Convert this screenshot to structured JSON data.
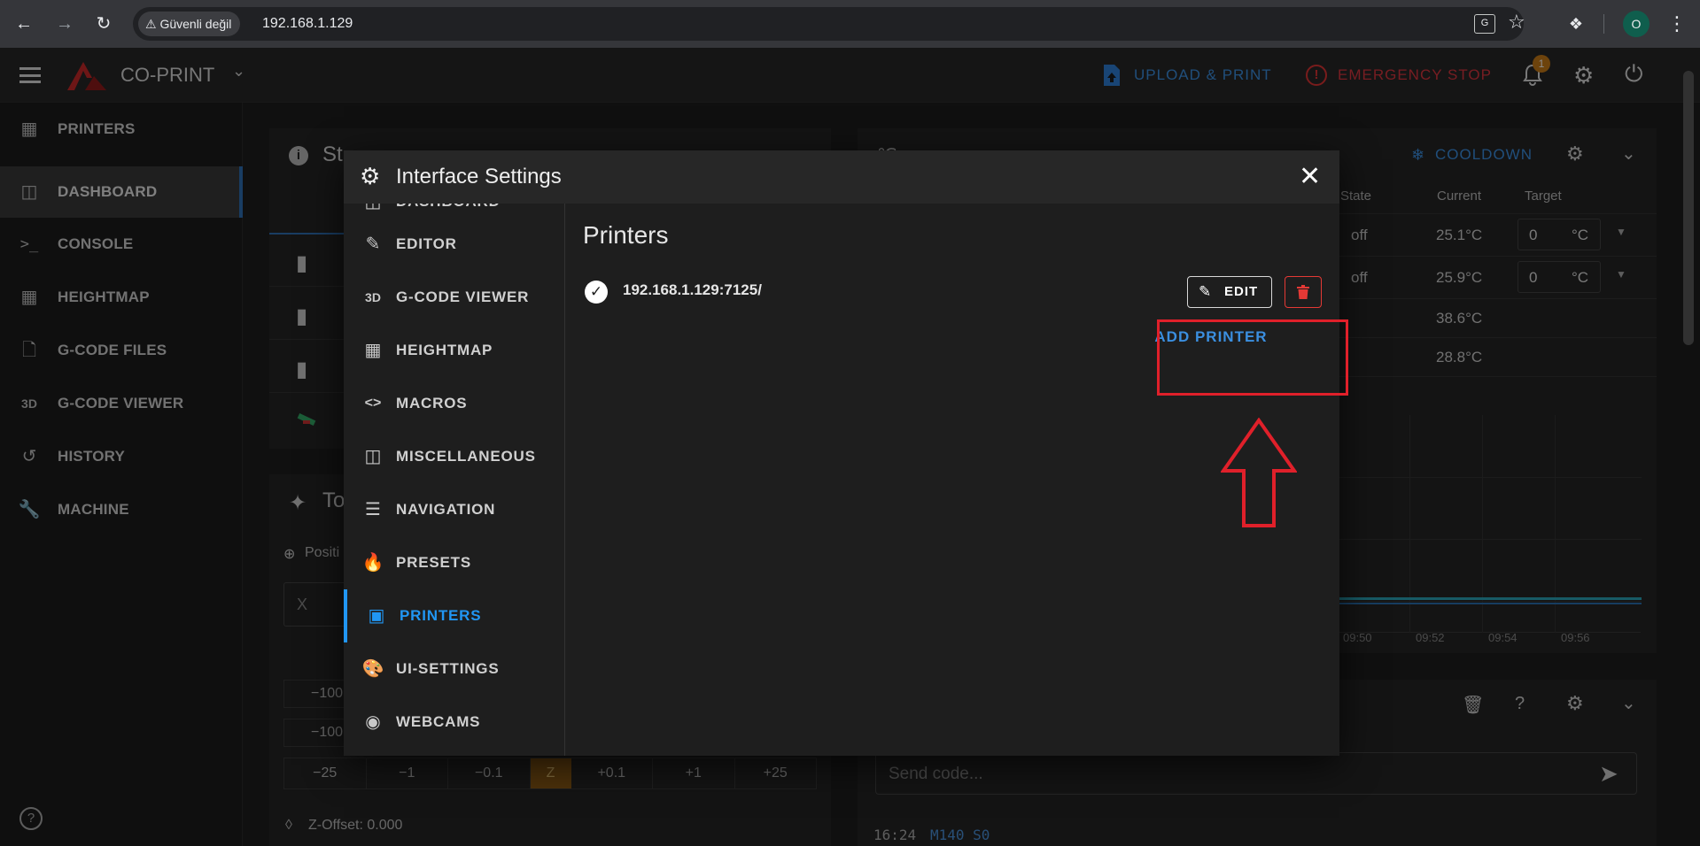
{
  "browser": {
    "security_label": "Güvenli değil",
    "url": "192.168.1.129",
    "profile_initial": "O"
  },
  "app": {
    "brand": "CO-PRINT",
    "upload_label": "UPLOAD & PRINT",
    "emergency_label": "EMERGENCY STOP",
    "notification_count": "1"
  },
  "sidebar": {
    "items": [
      {
        "label": "PRINTERS",
        "icon": "grid-icon"
      },
      {
        "label": "DASHBOARD",
        "icon": "monitor-icon"
      },
      {
        "label": "CONSOLE",
        "icon": "terminal-icon"
      },
      {
        "label": "HEIGHTMAP",
        "icon": "grid-icon"
      },
      {
        "label": "G-CODE FILES",
        "icon": "files-icon"
      },
      {
        "label": "G-CODE VIEWER",
        "icon": "3d-icon"
      },
      {
        "label": "HISTORY",
        "icon": "history-icon"
      },
      {
        "label": "MACHINE",
        "icon": "wrench-icon"
      }
    ]
  },
  "background": {
    "status_title": "St",
    "toolhead_title": "To",
    "position_label": "Positi",
    "x_label": "X",
    "z_offset": "Z-Offset: 0.000",
    "jog_row": [
      "−25",
      "−1",
      "−0.1",
      "Z",
      "+0.1",
      "+1",
      "+25"
    ],
    "jog_left": [
      "−100",
      "−100"
    ],
    "temps": {
      "cooldown_label": "COOLDOWN",
      "headers": [
        "State",
        "Current",
        "Target"
      ],
      "rows": [
        {
          "state": "off",
          "current": "25.1°C",
          "target": "0",
          "unit": "°C"
        },
        {
          "state": "off",
          "current": "25.9°C",
          "target": "0",
          "unit": "°C"
        },
        {
          "state": "",
          "current": "38.6°C",
          "target": "",
          "unit": ""
        },
        {
          "state": "",
          "current": "28.8°C",
          "target": "",
          "unit": ""
        }
      ],
      "time_ticks": [
        "09:50",
        "09:52",
        "09:54",
        "09:56"
      ]
    },
    "console": {
      "send_placeholder": "Send code...",
      "log_time": "16:24",
      "log_cmd": "M140 S0"
    }
  },
  "modal": {
    "title": "Interface Settings",
    "nav_partial": "DASHBOARD",
    "nav": [
      {
        "label": "EDITOR",
        "icon": "edit-file-icon"
      },
      {
        "label": "G-CODE VIEWER",
        "icon": "3d-icon"
      },
      {
        "label": "HEIGHTMAP",
        "icon": "grid-icon"
      },
      {
        "label": "MACROS",
        "icon": "code-icon"
      },
      {
        "label": "MISCELLANEOUS",
        "icon": "dashboard-icon"
      },
      {
        "label": "NAVIGATION",
        "icon": "menu-icon"
      },
      {
        "label": "PRESETS",
        "icon": "fire-icon"
      },
      {
        "label": "PRINTERS",
        "icon": "printer-icon"
      },
      {
        "label": "UI-SETTINGS",
        "icon": "palette-icon"
      },
      {
        "label": "WEBCAMS",
        "icon": "webcam-icon"
      }
    ],
    "section_title": "Printers",
    "printer_address": "192.168.1.129:7125/",
    "edit_label": "EDIT",
    "add_printer_label": "ADD PRINTER"
  },
  "colors": {
    "accent": "#2196f3",
    "danger": "#e53935",
    "highlight": "#e0202a"
  }
}
